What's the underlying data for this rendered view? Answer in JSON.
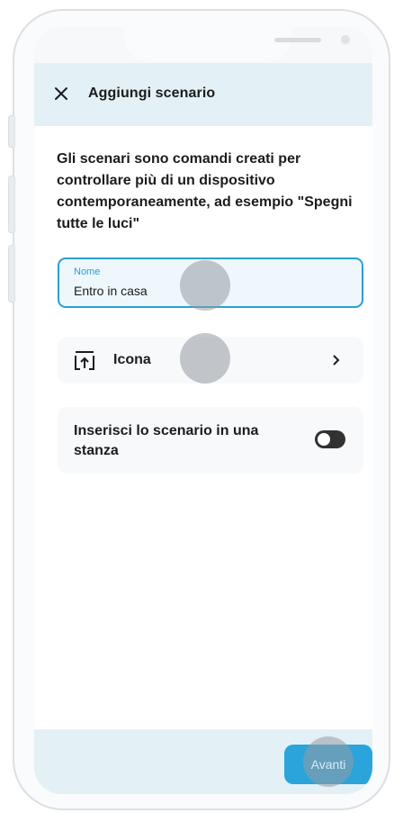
{
  "header": {
    "title": "Aggiungi scenario"
  },
  "intro": {
    "text": "Gli scenari sono comandi creati per controllare più di un dispositivo contemporaneamente, ad esempio \"Spegni tutte le luci\""
  },
  "name_field": {
    "label": "Nome",
    "value": "Entro in casa"
  },
  "icon_row": {
    "label": "Icona"
  },
  "room_row": {
    "label": "Inserisci lo scenario in una stanza",
    "toggle_on": false
  },
  "footer": {
    "next_label": "Avanti"
  },
  "colors": {
    "accent": "#2b9fd3",
    "header_bg": "#e3f1f7",
    "button": "#2ba4db",
    "toggle": "#323232"
  }
}
